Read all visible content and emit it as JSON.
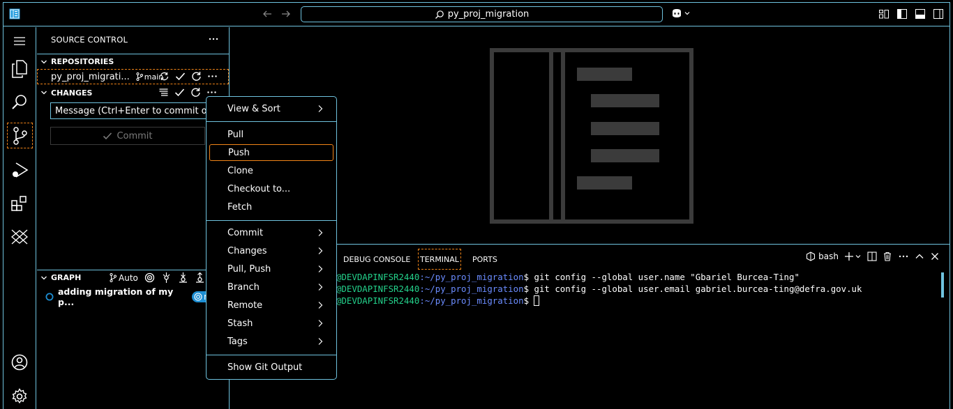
{
  "titlebar": {
    "search_text": "py_proj_migration"
  },
  "sidebar": {
    "title": "SOURCE CONTROL",
    "repositories_label": "REPOSITORIES",
    "repo_name": "py_proj_migrati...",
    "repo_branch": "main",
    "changes_label": "CHANGES",
    "message_placeholder": "Message (Ctrl+Enter to commit on \"...",
    "commit_label": "Commit",
    "graph_label": "GRAPH",
    "graph_auto": "Auto",
    "graph_commit": "adding migration of my p...",
    "graph_branch": "main"
  },
  "panel": {
    "tabs": [
      "DEBUG CONSOLE",
      "TERMINAL",
      "PORTS"
    ],
    "shell": "bash",
    "lines": [
      {
        "user": "@DEVDAPINFSR2440",
        "path": ":~/py_proj_migration",
        "cmd": "$ git config --global user.name \"Gbariel Burcea-Ting\""
      },
      {
        "user": "@DEVDAPINFSR2440",
        "path": ":~/py_proj_migration",
        "cmd": "$ git config --global user.email gabriel.burcea-ting@defra.gov.uk"
      },
      {
        "user": "@DEVDAPINFSR2440",
        "path": ":~/py_proj_migration",
        "cmd": "$ "
      }
    ]
  },
  "menu": {
    "items": [
      {
        "label": "View & Sort"
      },
      {
        "label": "Pull"
      },
      {
        "label": "Push"
      },
      {
        "label": "Clone"
      },
      {
        "label": "Checkout to..."
      },
      {
        "label": "Fetch"
      },
      {
        "label": "Commit"
      },
      {
        "label": "Changes"
      },
      {
        "label": "Pull, Push"
      },
      {
        "label": "Branch"
      },
      {
        "label": "Remote"
      },
      {
        "label": "Stash"
      },
      {
        "label": "Tags"
      },
      {
        "label": "Show Git Output"
      }
    ]
  },
  "icons": {
    "accent": "#6fc3df",
    "focus": "#f38518",
    "list": [
      "app-logo-icon",
      "arrow-left-icon",
      "arrow-right-icon",
      "search-icon",
      "copilot-icon",
      "explorer-icon",
      "source-control-icon",
      "run-debug-icon",
      "extensions-icon",
      "remote-icon",
      "account-icon",
      "settings-gear-icon"
    ]
  }
}
